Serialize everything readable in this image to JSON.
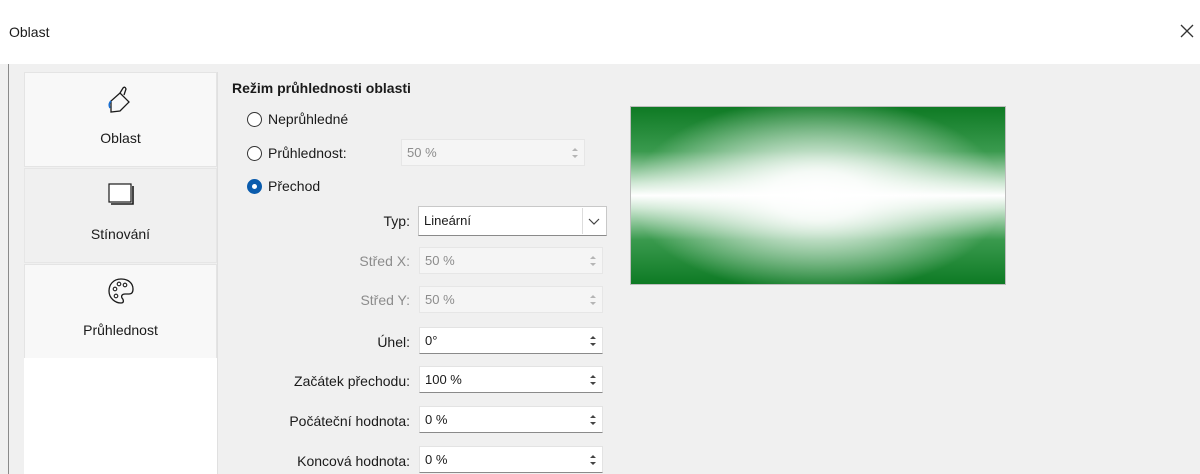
{
  "window": {
    "title": "Oblast"
  },
  "sidebar": {
    "items": [
      {
        "label": "Oblast",
        "icon": "paint-bucket-icon"
      },
      {
        "label": "Stínování",
        "icon": "shadow-rectangle-icon"
      },
      {
        "label": "Průhlednost",
        "icon": "palette-icon"
      }
    ]
  },
  "transparency": {
    "section_title": "Režim průhlednosti oblasti",
    "mode": {
      "options": [
        "Neprůhledné",
        "Průhlednost:",
        "Přechod"
      ],
      "selected": "Přechod"
    },
    "transparency_value": "50 %",
    "gradient": {
      "type_label": "Typ:",
      "type_value": "Lineární",
      "center_x_label": "Střed X:",
      "center_x_value": "50 %",
      "center_y_label": "Střed Y:",
      "center_y_value": "50 %",
      "angle_label": "Úhel:",
      "angle_value": "0°",
      "border_label": "Začátek přechodu:",
      "border_value": "100 %",
      "start_label": "Počáteční hodnota:",
      "start_value": "0 %",
      "end_label": "Koncová hodnota:",
      "end_value": "0 %"
    }
  },
  "preview": {
    "fill_color": "#0e7a24"
  }
}
